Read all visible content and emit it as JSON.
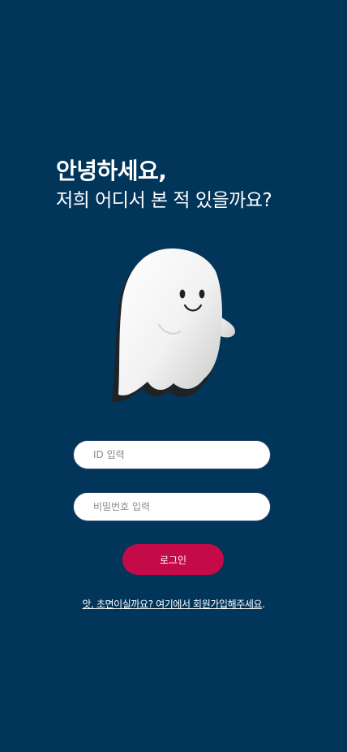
{
  "greeting": {
    "title": "안녕하세요,",
    "subtitle": "저희 어디서 본 적 있을까요?"
  },
  "mascot": {
    "icon": "ghost-icon"
  },
  "form": {
    "id_placeholder": "ID 입력",
    "id_value": "",
    "password_placeholder": "비밀번호 입력",
    "password_value": "",
    "login_label": "로그인"
  },
  "signup": {
    "link_text": "앗, 초면이실까요? 여기에서 회원가입해주세요",
    "suffix": "."
  },
  "colors": {
    "background": "#02355a",
    "button": "#c50a4a",
    "field": "#ffffff"
  }
}
